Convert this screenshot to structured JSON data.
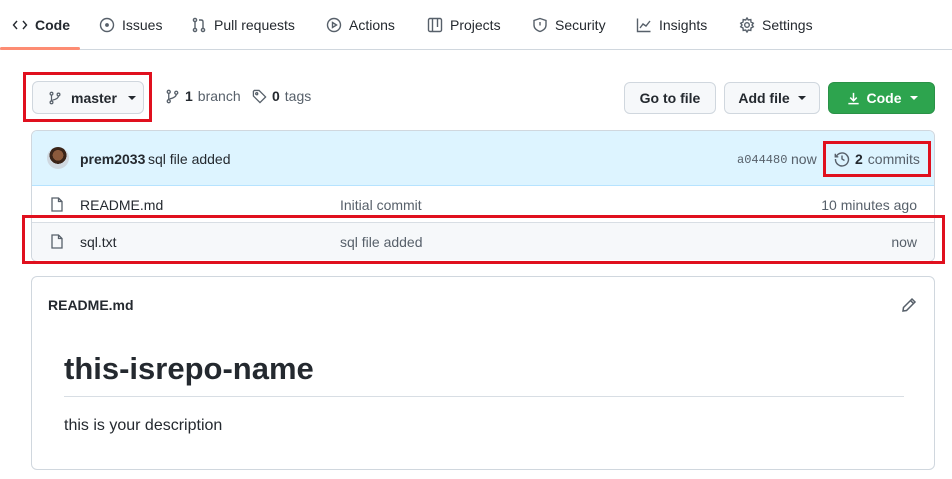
{
  "nav": {
    "tabs": [
      {
        "label": "Code",
        "icon": "code-icon"
      },
      {
        "label": "Issues",
        "icon": "issue-icon"
      },
      {
        "label": "Pull requests",
        "icon": "pull-request-icon"
      },
      {
        "label": "Actions",
        "icon": "play-icon"
      },
      {
        "label": "Projects",
        "icon": "table-icon"
      },
      {
        "label": "Security",
        "icon": "shield-icon"
      },
      {
        "label": "Insights",
        "icon": "graph-icon"
      },
      {
        "label": "Settings",
        "icon": "gear-icon"
      }
    ],
    "active_tab": "Code",
    "active_color": "#fd8c73"
  },
  "branch_bar": {
    "branch": "master",
    "branch_count": "1",
    "branch_label": "branch",
    "tag_count": "0",
    "tag_label": "tags",
    "go_to_file": "Go to file",
    "add_file": "Add file",
    "code_button": "Code",
    "code_button_color": "#2da44e"
  },
  "latest_commit": {
    "author": "prem2033",
    "message": "sql file added",
    "hash": "a044480",
    "age": "now",
    "commit_count": "2",
    "commit_label": "commits"
  },
  "files": [
    {
      "name": "README.md",
      "commit_message": "Initial commit",
      "age": "10 minutes ago",
      "icon": "file-icon"
    },
    {
      "name": "sql.txt",
      "commit_message": "sql file added",
      "age": "now",
      "icon": "file-icon"
    }
  ],
  "readme": {
    "filename": "README.md",
    "heading": "this-isrepo-name",
    "description": "this is your description"
  },
  "annotation_color": "#e0101e"
}
